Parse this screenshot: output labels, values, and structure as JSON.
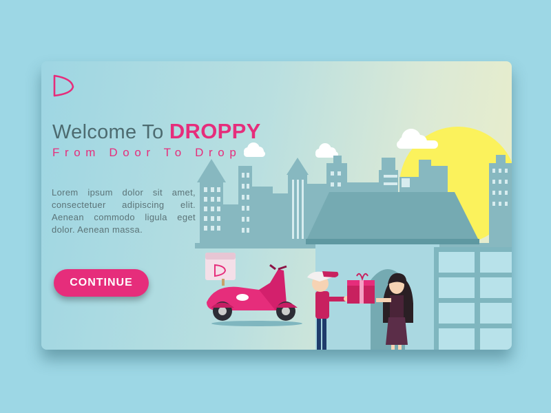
{
  "hero": {
    "title_prefix": "Welcome To",
    "brand": "DROPPY",
    "subtitle": "From Door To Drop",
    "description": "Lorem ipsum dolor sit amet, consectetuer adipiscing elit. Aenean commodo ligula eget dolor. Aenean massa.",
    "cta_label": "CONTINUE"
  },
  "icons": {
    "logo": "droppy-logo-icon",
    "scooter_box_logo": "droppy-logo-icon"
  },
  "colors": {
    "page_background": "#9dd7e5",
    "brand_pink": "#e62d7b",
    "heading_gray": "#4d6b70",
    "sun_yellow": "#fbf25c",
    "building_blue": "#87b8c0"
  }
}
